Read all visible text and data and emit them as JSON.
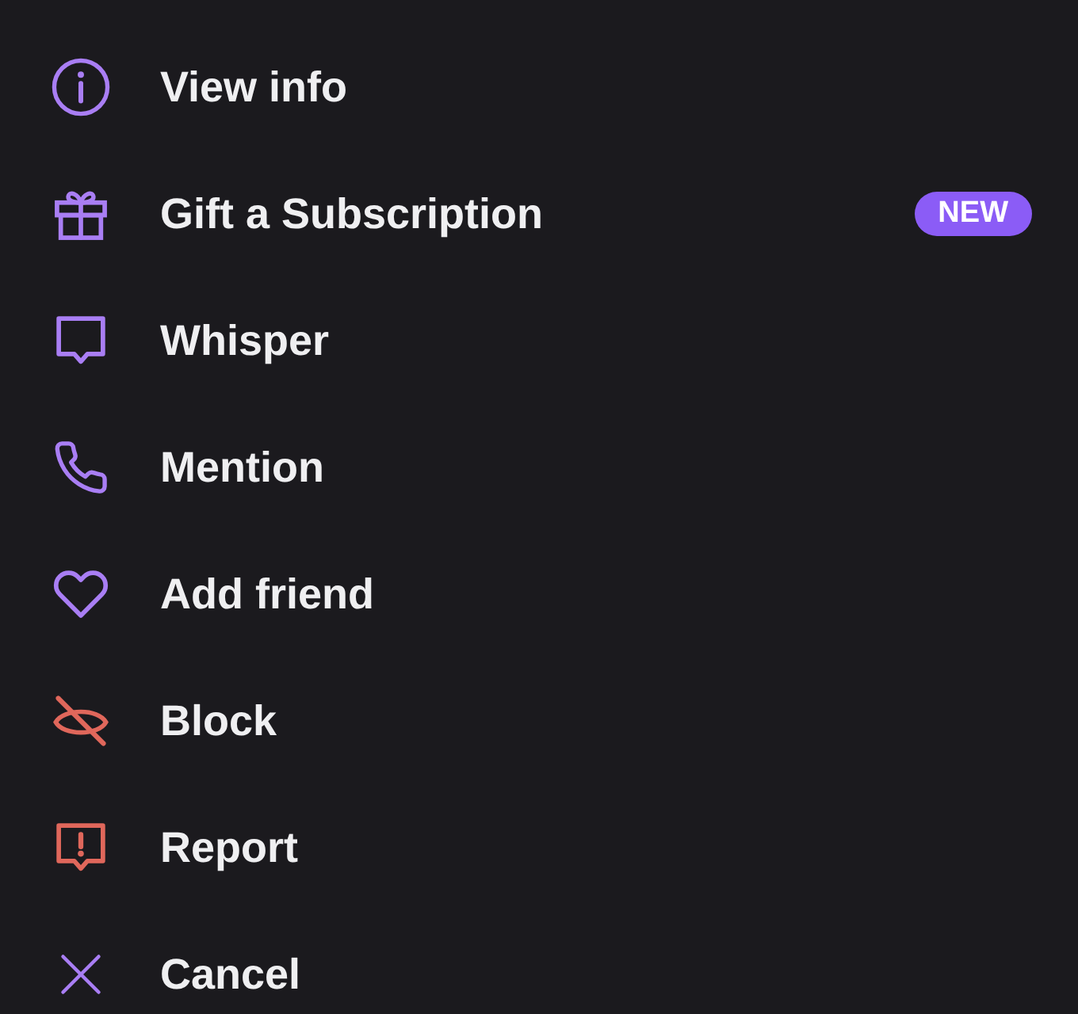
{
  "menu": {
    "items": [
      {
        "label": "View info",
        "danger": false
      },
      {
        "label": "Gift a Subscription",
        "danger": false,
        "badge": "NEW"
      },
      {
        "label": "Whisper",
        "danger": false
      },
      {
        "label": "Mention",
        "danger": false
      },
      {
        "label": "Add friend",
        "danger": false
      },
      {
        "label": "Block",
        "danger": true
      },
      {
        "label": "Report",
        "danger": true
      },
      {
        "label": "Cancel",
        "danger": false
      }
    ]
  }
}
